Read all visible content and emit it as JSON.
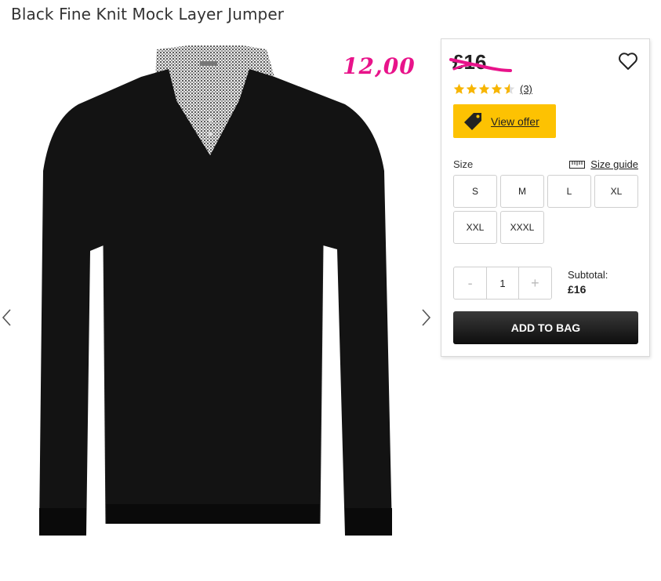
{
  "product": {
    "title": "Black Fine Knit Mock Layer Jumper",
    "sale_price_overlay": "12,00",
    "original_price": "£16",
    "rating": {
      "value": 4.5,
      "max": 5,
      "review_count": "(3)"
    }
  },
  "offer": {
    "label": "View offer"
  },
  "size": {
    "label": "Size",
    "guide_label": "Size guide",
    "options": [
      "S",
      "M",
      "L",
      "XL",
      "XXL",
      "XXXL"
    ]
  },
  "quantity": {
    "minus": "-",
    "value": "1",
    "plus": "+"
  },
  "subtotal": {
    "label": "Subtotal:",
    "value": "£16"
  },
  "cart": {
    "add_label": "ADD TO BAG"
  },
  "icons": {
    "wishlist": "heart-icon",
    "offer": "price-tag-icon",
    "size_guide": "ruler-icon",
    "gallery_prev": "chevron-left-icon",
    "gallery_next": "chevron-right-icon"
  },
  "colors": {
    "sale_price": "#e8138a",
    "strike": "#e8138a",
    "offer_button": "#fdc202",
    "stars": "#f7b500",
    "add_button": "#1a1a1a"
  }
}
